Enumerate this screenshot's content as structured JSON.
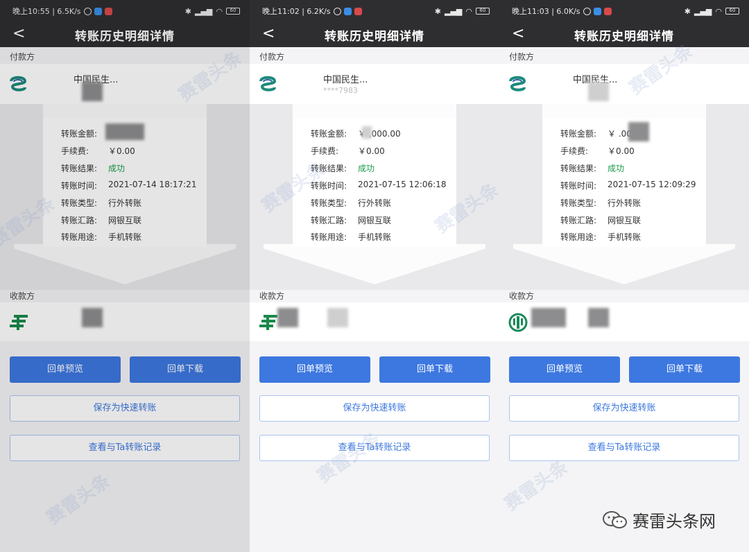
{
  "screens": [
    {
      "status": {
        "time_speed": "晚上10:55 | 6.5K/s",
        "battery": "60"
      },
      "nav": {
        "title": "转账历史明细详情"
      },
      "payer": {
        "label": "付款方",
        "bank": "中国民生...",
        "card": ""
      },
      "details": [
        {
          "k": "转账金额:",
          "v": ""
        },
        {
          "k": "手续费:",
          "v": "￥0.00"
        },
        {
          "k": "转账结果:",
          "v": "成功"
        },
        {
          "k": "转账时间:",
          "v": "2021-07-14 18:17:21"
        },
        {
          "k": "转账类型:",
          "v": "行外转账"
        },
        {
          "k": "转账汇路:",
          "v": "网银互联"
        },
        {
          "k": "转账用途:",
          "v": "手机转账"
        }
      ],
      "payee": {
        "label": "收款方"
      },
      "buttons": {
        "preview": "回单预览",
        "download": "回单下载",
        "save": "保存为快速转账",
        "records": "查看与Ta转账记录"
      }
    },
    {
      "status": {
        "time_speed": "晚上11:02 | 6.2K/s",
        "battery": "60"
      },
      "nav": {
        "title": "转账历史明细详情"
      },
      "payer": {
        "label": "付款方",
        "bank": "中国民生...",
        "card": "****7983"
      },
      "details": [
        {
          "k": "转账金额:",
          "v": "￥ ,000.00"
        },
        {
          "k": "手续费:",
          "v": "￥0.00"
        },
        {
          "k": "转账结果:",
          "v": "成功"
        },
        {
          "k": "转账时间:",
          "v": "2021-07-15 12:06:18"
        },
        {
          "k": "转账类型:",
          "v": "行外转账"
        },
        {
          "k": "转账汇路:",
          "v": "网银互联"
        },
        {
          "k": "转账用途:",
          "v": "手机转账"
        }
      ],
      "payee": {
        "label": "收款方"
      },
      "buttons": {
        "preview": "回单预览",
        "download": "回单下载",
        "save": "保存为快速转账",
        "records": "查看与Ta转账记录"
      }
    },
    {
      "status": {
        "time_speed": "晚上11:03 | 6.0K/s",
        "battery": "60"
      },
      "nav": {
        "title": "转账历史明细详情"
      },
      "payer": {
        "label": "付款方",
        "bank": "中国民生...",
        "card": ""
      },
      "details": [
        {
          "k": "转账金额:",
          "v": "￥ .00"
        },
        {
          "k": "手续费:",
          "v": "￥0.00"
        },
        {
          "k": "转账结果:",
          "v": "成功"
        },
        {
          "k": "转账时间:",
          "v": "2021-07-15 12:09:29"
        },
        {
          "k": "转账类型:",
          "v": "行外转账"
        },
        {
          "k": "转账汇路:",
          "v": "网银互联"
        },
        {
          "k": "转账用途:",
          "v": "手机转账"
        }
      ],
      "payee": {
        "label": "收款方"
      },
      "buttons": {
        "preview": "回单预览",
        "download": "回单下载",
        "save": "保存为快速转账",
        "records": "查看与Ta转账记录"
      }
    }
  ],
  "watermark": "赛雷头条",
  "brand": {
    "name": "赛雷头条网",
    "icon": "wechat-icon"
  },
  "colors": {
    "primary": "#3d78e0",
    "success": "#1a9a4b",
    "header": "#2e2e31"
  }
}
